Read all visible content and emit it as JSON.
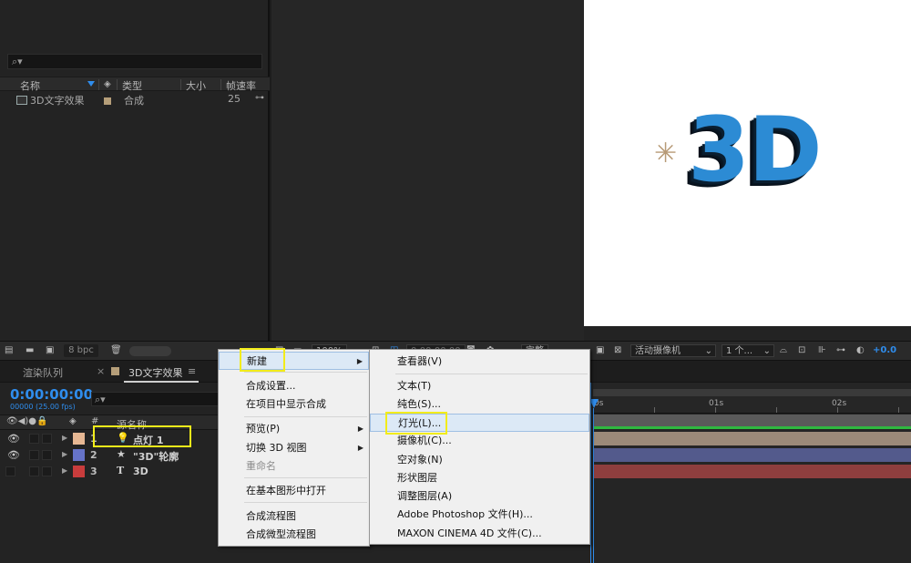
{
  "project": {
    "search_placeholder": "",
    "columns": [
      "名称",
      "类型",
      "大小",
      "帧速率"
    ],
    "rows": [
      {
        "name": "3D文字效果",
        "type": "合成",
        "size": "",
        "fps": "25"
      }
    ]
  },
  "toolbar": {
    "bpc": "8 bpc",
    "zoom": "100%",
    "time": "0:00:00:00",
    "quality": "完整",
    "camera": "活动摄像机",
    "views": "1 个...",
    "exposure": "+0.0"
  },
  "viewer": {
    "text": "3D",
    "text_color": "#2c8bd4"
  },
  "timeline": {
    "tabs": [
      "渲染队列",
      "3D文字效果"
    ],
    "tab_close": "×",
    "tab_menu": "≡",
    "current_time": "0:00:00:00",
    "fps_line": "00000 (25.00 fps)",
    "header_name": "源名称",
    "ruler": [
      "0s",
      "01s",
      "02s"
    ],
    "layers": [
      {
        "num": "1",
        "icon": "💡",
        "name": "点灯 1",
        "color": "#e7b894",
        "bar": "#9c8a79"
      },
      {
        "num": "2",
        "icon": "★",
        "name": "\"3D\"轮廓",
        "color": "#6673c8",
        "bar": "#535a8c"
      },
      {
        "num": "3",
        "icon": "T",
        "name": "3D",
        "color": "#c83c3c",
        "bar": "#8e3e3e"
      }
    ]
  },
  "context_menu": {
    "items": [
      {
        "label": "新建",
        "submenu": true
      },
      {
        "label": "合成设置..."
      },
      {
        "label": "在项目中显示合成"
      },
      {
        "label": "预览(P)",
        "submenu": true
      },
      {
        "label": "切换 3D 视图",
        "submenu": true
      },
      {
        "label": "重命名",
        "disabled": true
      },
      {
        "label": "在基本图形中打开"
      },
      {
        "label": "合成流程图"
      },
      {
        "label": "合成微型流程图"
      }
    ]
  },
  "submenu": {
    "items": [
      {
        "label": "查看器(V)"
      },
      {
        "label": "文本(T)"
      },
      {
        "label": "纯色(S)..."
      },
      {
        "label": "灯光(L)..."
      },
      {
        "label": "摄像机(C)..."
      },
      {
        "label": "空对象(N)"
      },
      {
        "label": "形状图层"
      },
      {
        "label": "调整图层(A)"
      },
      {
        "label": "Adobe Photoshop 文件(H)..."
      },
      {
        "label": "MAXON CINEMA 4D 文件(C)..."
      }
    ]
  }
}
